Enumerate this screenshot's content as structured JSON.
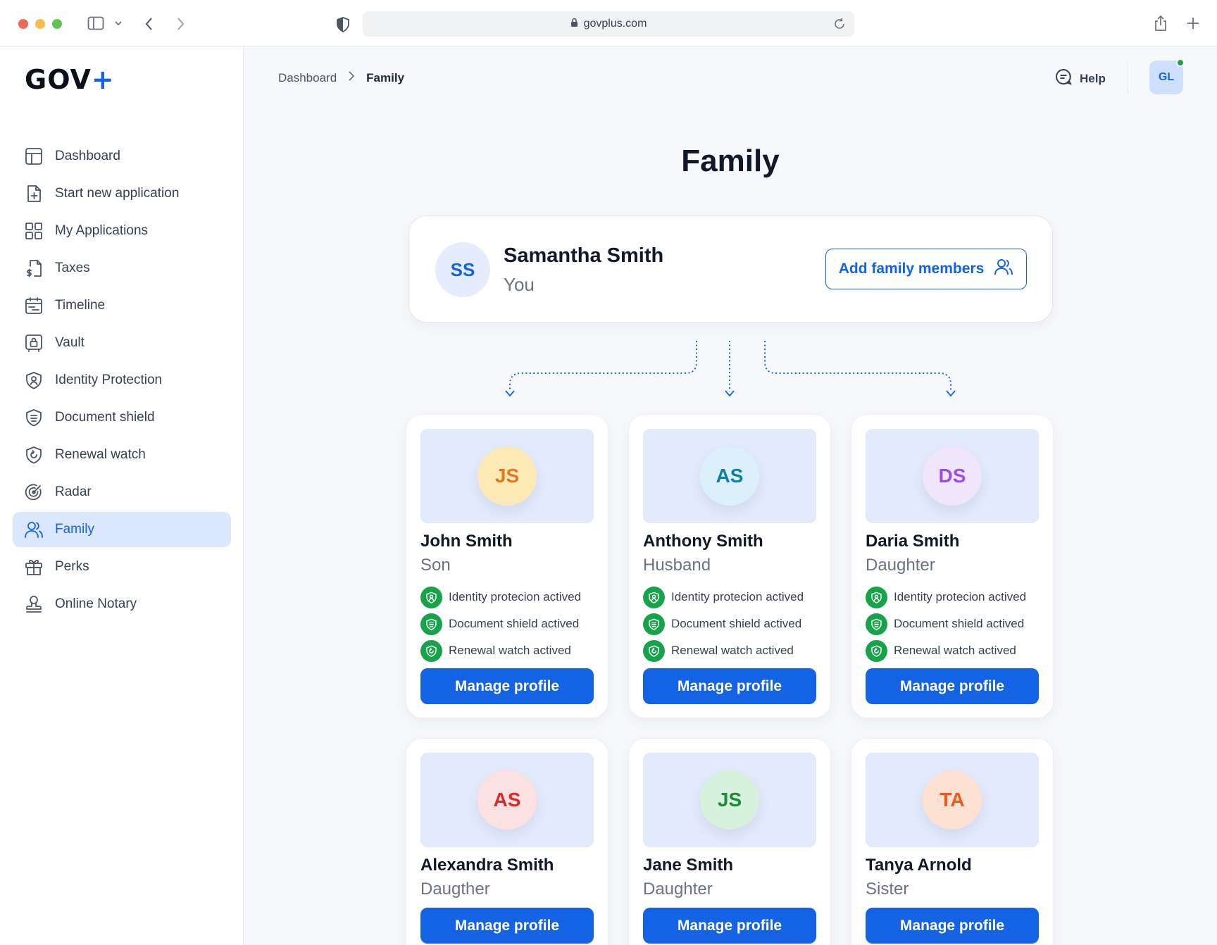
{
  "browser": {
    "url": "govplus.com",
    "icons": [
      "sidebar-toggle-icon",
      "chevron-down-icon",
      "back-icon",
      "forward-icon",
      "shield-icon",
      "lock-icon",
      "reload-icon",
      "share-icon",
      "new-tab-icon"
    ]
  },
  "brand": {
    "name": "GOV",
    "plus": "+"
  },
  "sidebar": {
    "items": [
      {
        "label": "Dashboard",
        "icon": "dashboard-icon",
        "active": false
      },
      {
        "label": "Start new application",
        "icon": "file-plus-icon",
        "active": false
      },
      {
        "label": "My Applications",
        "icon": "grid-icon",
        "active": false
      },
      {
        "label": "Taxes",
        "icon": "taxes-icon",
        "active": false
      },
      {
        "label": "Timeline",
        "icon": "calendar-icon",
        "active": false
      },
      {
        "label": "Vault",
        "icon": "vault-icon",
        "active": false
      },
      {
        "label": "Identity Protection",
        "icon": "identity-shield-icon",
        "active": false
      },
      {
        "label": "Document shield",
        "icon": "document-shield-icon",
        "active": false
      },
      {
        "label": "Renewal watch",
        "icon": "renewal-shield-icon",
        "active": false
      },
      {
        "label": "Radar",
        "icon": "radar-icon",
        "active": false
      },
      {
        "label": "Family",
        "icon": "family-icon",
        "active": true
      },
      {
        "label": "Perks",
        "icon": "gift-icon",
        "active": false
      },
      {
        "label": "Online Notary",
        "icon": "notary-icon",
        "active": false
      }
    ]
  },
  "header": {
    "breadcrumb": {
      "parent": "Dashboard",
      "current": "Family"
    },
    "help_label": "Help",
    "user_initials": "GL"
  },
  "page": {
    "title": "Family"
  },
  "me": {
    "initials": "SS",
    "name": "Samantha Smith",
    "role": "You",
    "add_button_label": "Add family members"
  },
  "members": [
    {
      "initials": "JS",
      "name": "John Smith",
      "role": "Son",
      "avatar_bg": "#fde9b5",
      "avatar_color": "#e07a1f",
      "statuses": [
        "Identity protecion actived",
        "Document shield actived",
        "Renewal watch actived"
      ],
      "button_label": "Manage profile"
    },
    {
      "initials": "AS",
      "name": "Anthony Smith",
      "role": "Husband",
      "avatar_bg": "#dcf0fb",
      "avatar_color": "#0e7fa8",
      "statuses": [
        "Identity protecion actived",
        "Document shield actived",
        "Renewal watch actived"
      ],
      "button_label": "Manage profile"
    },
    {
      "initials": "DS",
      "name": "Daria Smith",
      "role": "Daughter",
      "avatar_bg": "#efe6fb",
      "avatar_color": "#9b4fe0",
      "statuses": [
        "Identity protecion actived",
        "Document shield actived",
        "Renewal watch actived"
      ],
      "button_label": "Manage profile"
    },
    {
      "initials": "AS",
      "name": "Alexandra Smith",
      "role": "Daugther",
      "avatar_bg": "#fce1e3",
      "avatar_color": "#d62b2b",
      "statuses": [],
      "button_label": "Manage profile"
    },
    {
      "initials": "JS",
      "name": "Jane Smith",
      "role": "Daughter",
      "avatar_bg": "#d6f1dc",
      "avatar_color": "#1e8a3a",
      "statuses": [],
      "button_label": "Manage profile"
    },
    {
      "initials": "TA",
      "name": "Tanya Arnold",
      "role": "Sister",
      "avatar_bg": "#fde1d3",
      "avatar_color": "#ef5a1c",
      "statuses": [],
      "button_label": "Manage profile"
    }
  ],
  "colors": {
    "accent": "#1463e4",
    "success": "#16a34a",
    "active_nav_bg": "#dbe8ff"
  }
}
